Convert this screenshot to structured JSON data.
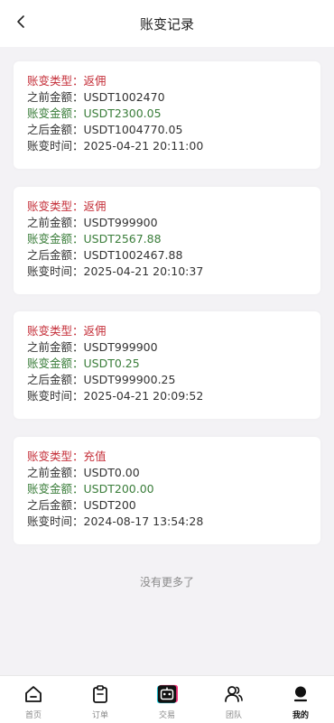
{
  "header": {
    "title": "账变记录"
  },
  "records": [
    {
      "type_label": "账变类型：",
      "type_value": "返佣",
      "before_label": "之前金额：",
      "before_value": "USDT1002470",
      "change_label": "账变金额：",
      "change_value": "USDT2300.05",
      "after_label": "之后金额：",
      "after_value": "USDT1004770.05",
      "time_label": "账变时间：",
      "time_value": "2025-04-21 20:11:00"
    },
    {
      "type_label": "账变类型：",
      "type_value": "返佣",
      "before_label": "之前金额：",
      "before_value": "USDT999900",
      "change_label": "账变金额：",
      "change_value": "USDT2567.88",
      "after_label": "之后金额：",
      "after_value": "USDT1002467.88",
      "time_label": "账变时间：",
      "time_value": "2025-04-21 20:10:37"
    },
    {
      "type_label": "账变类型：",
      "type_value": "返佣",
      "before_label": "之前金额：",
      "before_value": "USDT999900",
      "change_label": "账变金额：",
      "change_value": "USDT0.25",
      "after_label": "之后金额：",
      "after_value": "USDT999900.25",
      "time_label": "账变时间：",
      "time_value": "2025-04-21 20:09:52"
    },
    {
      "type_label": "账变类型：",
      "type_value": "充值",
      "before_label": "之前金额：",
      "before_value": "USDT0.00",
      "change_label": "账变金额：",
      "change_value": "USDT200.00",
      "after_label": "之后金额：",
      "after_value": "USDT200",
      "time_label": "账变时间：",
      "time_value": "2024-08-17 13:54:28"
    }
  ],
  "footer_note": "没有更多了",
  "tabbar": {
    "tabs": [
      {
        "label": "首页",
        "icon": "home-icon"
      },
      {
        "label": "订单",
        "icon": "clipboard-icon"
      },
      {
        "label": "交易",
        "icon": "robot-icon"
      },
      {
        "label": "团队",
        "icon": "team-icon"
      },
      {
        "label": "我的",
        "icon": "user-icon"
      }
    ],
    "active_index": 4
  },
  "colors": {
    "type_text": "#c5303a",
    "change_text": "#3a7d3a",
    "body_text": "#333333",
    "background": "#f3f2f5",
    "trade_icon_accent_cyan": "#22d3e6",
    "trade_icon_accent_pink": "#f0357a"
  }
}
